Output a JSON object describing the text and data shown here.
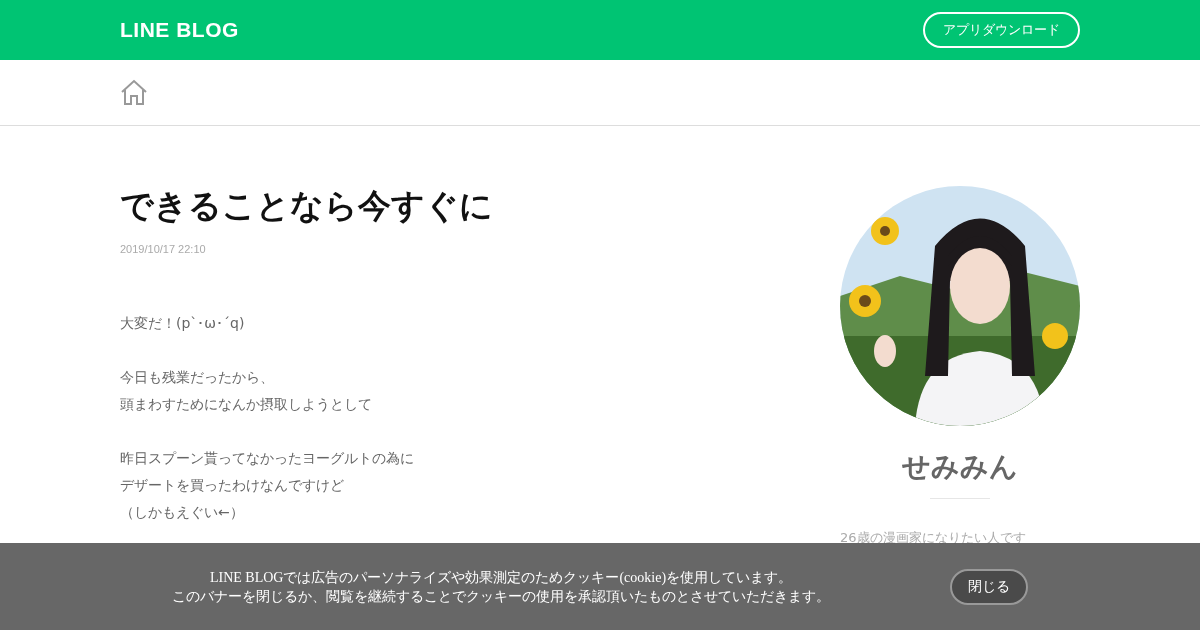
{
  "header": {
    "logo": "LINE BLOG",
    "download_button": "アプリダウンロード"
  },
  "article": {
    "title": "できることなら今すぐに",
    "date": "2019/10/17 22:10",
    "paragraphs": [
      [
        "大変だ！(p`･ω･´q)"
      ],
      [
        "今日も残業だったから、",
        "頭まわすためになんか摂取しようとして"
      ],
      [
        "昨日スプーン貰ってなかったヨーグルトの為に",
        "デザートを買ったわけなんですけど",
        "（しかもえぐい←）"
      ]
    ]
  },
  "profile": {
    "name": "せみみん",
    "bio": "26歳の漫画家になりたい人です"
  },
  "cookie_banner": {
    "lines": [
      "LINE BLOGでは広告のパーソナライズや効果測定のためクッキー(cookie)を使用しています。",
      "このバナーを閉じるか、閲覧を継続することでクッキーの使用を承認頂いたものとさせていただきます。"
    ],
    "close_button": "閉じる"
  }
}
